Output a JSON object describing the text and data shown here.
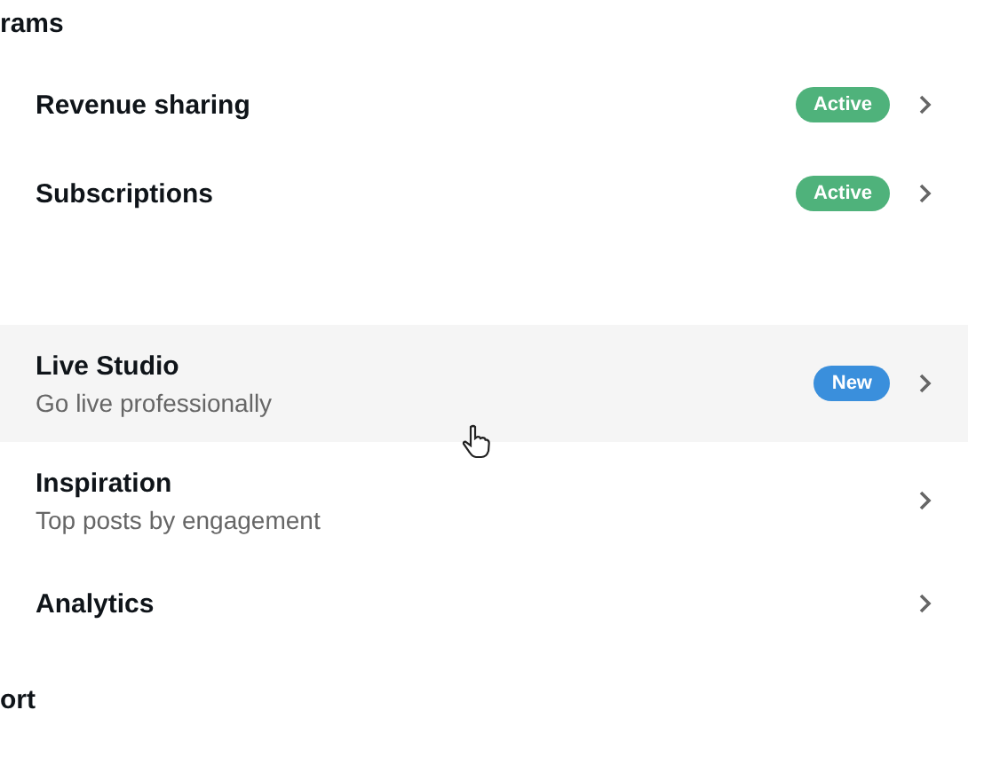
{
  "sections": [
    {
      "heading": "rams",
      "items": [
        {
          "title": "Revenue sharing",
          "badge": {
            "label": "Active",
            "color": "#4fb27b"
          }
        },
        {
          "title": "Subscriptions",
          "badge": {
            "label": "Active",
            "color": "#4fb27b"
          }
        }
      ]
    },
    {
      "items": [
        {
          "title": "Live Studio",
          "subtitle": "Go live professionally",
          "badge": {
            "label": "New",
            "color": "#3a8fdc"
          },
          "hovered": true
        },
        {
          "title": "Inspiration",
          "subtitle": "Top posts by engagement"
        },
        {
          "title": "Analytics"
        }
      ]
    },
    {
      "heading": "ort"
    }
  ]
}
